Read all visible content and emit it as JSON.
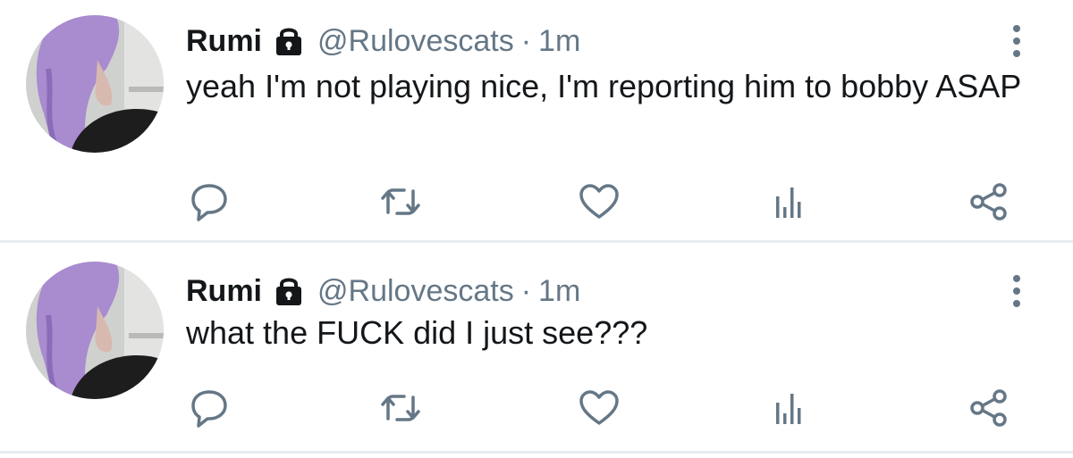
{
  "colors": {
    "text": "#14171a",
    "secondary": "#657786",
    "divider": "#e6ecf0",
    "avatar_hair": "#a98bd0"
  },
  "tweets": [
    {
      "name": "Rumi",
      "handle": "@Rulovescats",
      "separator": "·",
      "time": "1m",
      "text": "yeah I'm not playing nice, I'm reporting him to bobby ASAP",
      "icons": [
        "lock-icon",
        "more-icon",
        "reply-icon",
        "retweet-icon",
        "like-icon",
        "stats-icon",
        "share-icon"
      ]
    },
    {
      "name": "Rumi",
      "handle": "@Rulovescats",
      "separator": "·",
      "time": "1m",
      "text": "what the FUCK did I just see???",
      "icons": [
        "lock-icon",
        "more-icon",
        "reply-icon",
        "retweet-icon",
        "like-icon",
        "stats-icon",
        "share-icon"
      ]
    }
  ]
}
